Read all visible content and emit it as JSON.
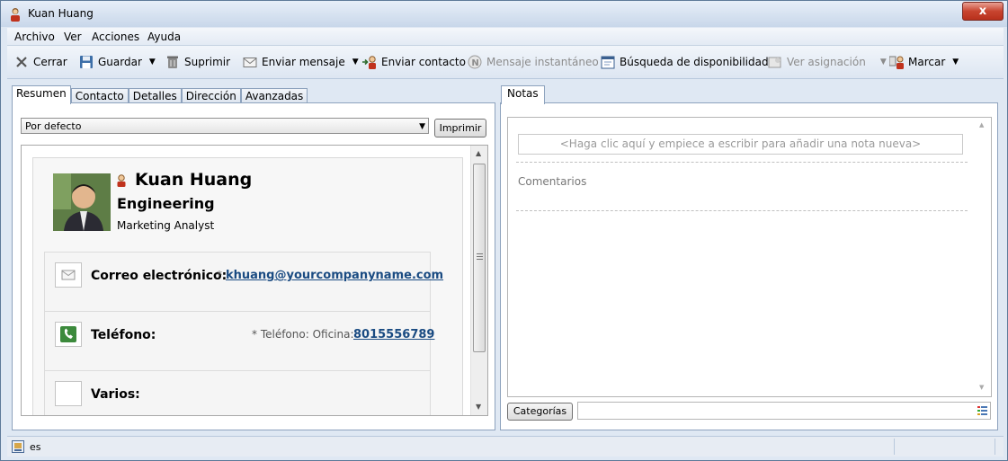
{
  "window": {
    "title": "Kuan Huang",
    "close_label": "x"
  },
  "menu": {
    "items": [
      "Archivo",
      "Ver",
      "Acciones",
      "Ayuda"
    ]
  },
  "toolbar": {
    "close": "Cerrar",
    "save": "Guardar",
    "delete": "Suprimir",
    "send_message": "Enviar mensaje",
    "send_contact": "Enviar contacto",
    "instant_message": "Mensaje instantáneo",
    "availability": "Búsqueda de disponibilidad",
    "view_assignment": "Ver asignación",
    "dial": "Marcar"
  },
  "left_tabs": [
    "Resumen",
    "Contacto",
    "Detalles",
    "Dirección",
    "Avanzadas"
  ],
  "view_select": {
    "value": "Por defecto"
  },
  "print_button": "Imprimir",
  "contact": {
    "name": "Kuan Huang",
    "department": "Engineering",
    "job_title": "Marketing Analyst",
    "email_label": "Correo electrónico:",
    "email_marker": "*",
    "email": "khuang@yourcompanyname.com",
    "phone_label": "Teléfono:",
    "phone_type": "* Teléfono: Oficina:",
    "phone": "8015556789",
    "misc_label": "Varios:"
  },
  "right_tabs": [
    "Notas"
  ],
  "notes": {
    "placeholder": "<Haga clic aquí y empiece a escribir para añadir una nota nueva>",
    "comments_label": "Comentarios",
    "categories_button": "Categorías",
    "categories_value": ""
  },
  "status": {
    "language": "es"
  },
  "colors": {
    "link": "#1a4b82",
    "close_button": "#c8442f",
    "accent": "#8da2bd"
  }
}
